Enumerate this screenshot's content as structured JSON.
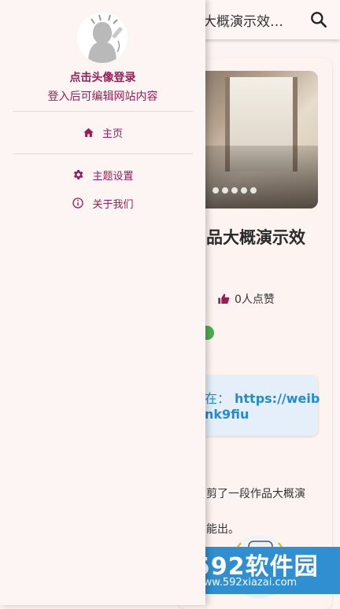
{
  "topbar": {
    "title": "大概演示效…"
  },
  "post": {
    "title": "品大概演示效",
    "likes": "0人点赞",
    "link_prefix": "在：",
    "link_url_part1": "https://weib",
    "link_url_part2": "nk9fiu",
    "para1": "剪了一段作品大概演",
    "para2": "能出。"
  },
  "drawer": {
    "login_title": "点击头像登录",
    "login_subtitle": "登入后可编辑网站内容",
    "menu": [
      {
        "label": "主页",
        "icon": "home-icon"
      },
      {
        "label": "主题设置",
        "icon": "gear-icon"
      },
      {
        "label": "关于我们",
        "icon": "info-icon"
      }
    ]
  },
  "watermark": {
    "brand": "592软件园",
    "url": "www.592xiazai.com"
  },
  "colors": {
    "accent": "#9b1b55",
    "link": "#1f8dd6",
    "link_bg": "#e4eff9",
    "drawer_bg": "#fdf5f3"
  }
}
